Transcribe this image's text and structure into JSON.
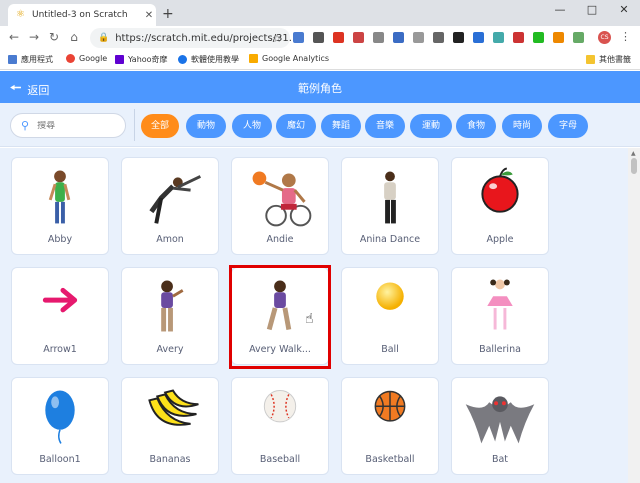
{
  "browser": {
    "tab_title": "Untitled-3 on Scratch",
    "tab_close": "✕",
    "newtab": "+",
    "url": "https://scratch.mit.edu/projects/31...",
    "bookmarks": [
      "應用程式",
      "Google",
      "Yahoo奇摩",
      "軟體使用教學",
      "Google Analytics"
    ],
    "other_bookmarks": "其他書籤",
    "profile_initials": "CS"
  },
  "header": {
    "back_label": "返回",
    "title": "範例角色"
  },
  "search": {
    "placeholder": "搜尋"
  },
  "categories": [
    "全部",
    "動物",
    "人物",
    "魔幻",
    "舞蹈",
    "音樂",
    "運動",
    "食物",
    "時尚",
    "字母"
  ],
  "active_category": "全部",
  "sprites": [
    "Abby",
    "Amon",
    "Andie",
    "Anina Dance",
    "Apple",
    "Arrow1",
    "Avery",
    "Avery Walk...",
    "Ball",
    "Ballerina",
    "Balloon1",
    "Bananas",
    "Baseball",
    "Basketball",
    "Bat"
  ],
  "colors": {
    "accent": "#4c97ff",
    "active": "#ff8c1a",
    "highlight": "#e00000"
  }
}
